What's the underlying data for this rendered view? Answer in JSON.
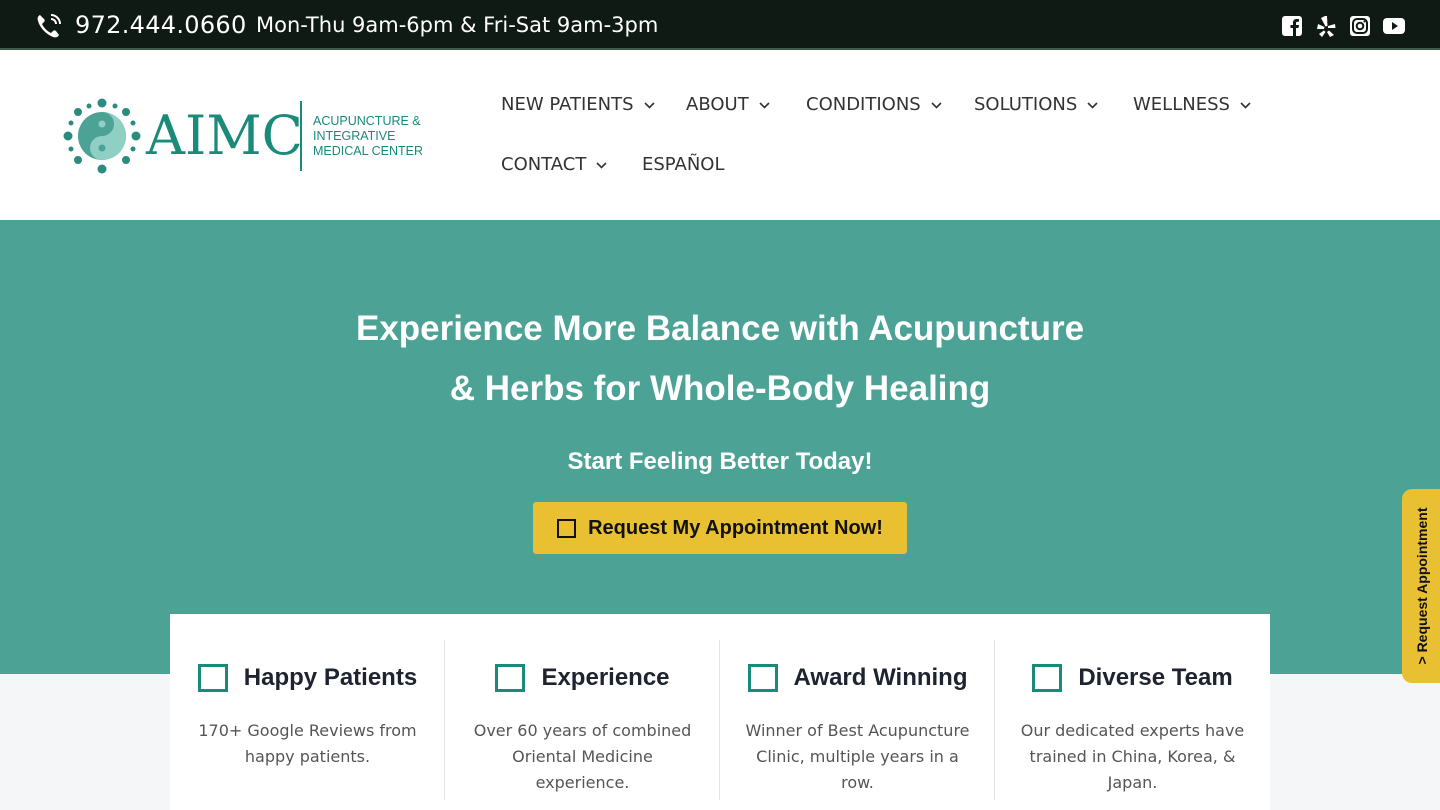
{
  "topbar": {
    "phone": "972.444.0660",
    "hours": "Mon-Thu 9am-6pm & Fri-Sat 9am-3pm",
    "social": [
      "facebook-icon",
      "yelp-icon",
      "instagram-icon",
      "youtube-icon"
    ]
  },
  "logo": {
    "name": "AIMC",
    "line1": "ACUPUNCTURE &",
    "line2": "INTEGRATIVE",
    "line3": "MEDICAL CENTER"
  },
  "nav": {
    "new_patients": "NEW PATIENTS",
    "about": "ABOUT",
    "conditions": "CONDITIONS",
    "solutions": "SOLUTIONS",
    "wellness": "WELLNESS",
    "contact": "CONTACT",
    "espanol": "ESPAÑOL"
  },
  "hero": {
    "title_line1": "Experience More Balance with Acupuncture",
    "title_line2": "& Herbs for Whole-Body Healing",
    "subtitle": "Start Feeling Better Today!",
    "cta": "Request My Appointment Now!"
  },
  "side_tab": "> Request Appointment",
  "features": [
    {
      "title": "Happy Patients",
      "desc": "170+ Google Reviews from happy patients."
    },
    {
      "title": "Experience",
      "desc": "Over 60 years of combined Oriental Medicine experience."
    },
    {
      "title": "Award Winning",
      "desc": "Winner of Best Acupuncture Clinic, multiple years in a row."
    },
    {
      "title": "Diverse Team",
      "desc": "Our dedicated experts have trained in China, Korea, & Japan."
    }
  ],
  "colors": {
    "brand_teal": "#1a8a7a",
    "hero_bg": "#4ba295",
    "cta_yellow": "#e9c032",
    "topbar_bg": "#0f1a14"
  }
}
